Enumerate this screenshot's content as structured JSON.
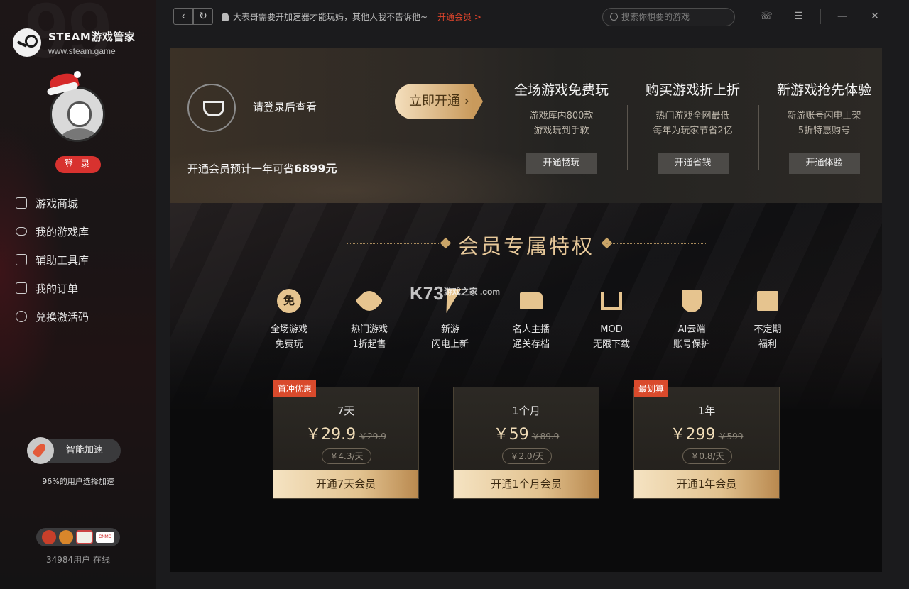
{
  "sidebar": {
    "logo_title": "STEAM游戏管家",
    "logo_url": "www.steam.game",
    "login_label": "登 录",
    "nav": [
      {
        "label": "游戏商城",
        "icon": "store-icon"
      },
      {
        "label": "我的游戏库",
        "icon": "gamepad-icon"
      },
      {
        "label": "辅助工具库",
        "icon": "toolbox-icon"
      },
      {
        "label": "我的订单",
        "icon": "order-icon"
      },
      {
        "label": "兑换激活码",
        "icon": "redeem-icon"
      }
    ],
    "speed_label": "智能加速",
    "speed_sub": "96%的用户选择加速",
    "badge_text": "CNMC",
    "online": "34984用户 在线"
  },
  "topbar": {
    "notice": "大表哥需要开加速器才能玩妈，其他人我不告诉他~",
    "notice_link": "开通会员 >",
    "search_placeholder": "搜索你想要的游戏"
  },
  "promo": {
    "login_text": "请登录后查看",
    "save_text_prefix": "开通会员预计一年可省",
    "save_amount": "6899元",
    "open_button": "立即开通",
    "benefits": [
      {
        "title": "全场游戏免费玩",
        "line1": "游戏库内800款",
        "line2": "游戏玩到手软",
        "button": "开通畅玩"
      },
      {
        "title": "购买游戏折上折",
        "line1": "热门游戏全网最低",
        "line2": "每年为玩家节省2亿",
        "button": "开通省钱"
      },
      {
        "title": "新游戏抢先体验",
        "line1": "新游账号闪电上架",
        "line2": "5折特惠购号",
        "button": "开通体验"
      }
    ]
  },
  "members": {
    "title": "会员专属特权",
    "features": [
      {
        "line1": "全场游戏",
        "line2": "免费玩",
        "icon": "free-icon",
        "glyph": "免"
      },
      {
        "line1": "热门游戏",
        "line2": "1折起售",
        "icon": "tag-icon"
      },
      {
        "line1": "新游",
        "line2": "闪电上新",
        "icon": "lightning-icon"
      },
      {
        "line1": "名人主播",
        "line2": "通关存档",
        "icon": "folder-icon"
      },
      {
        "line1": "MOD",
        "line2": "无限下载",
        "icon": "download-icon"
      },
      {
        "line1": "AI云端",
        "line2": "账号保护",
        "icon": "shield-icon"
      },
      {
        "line1": "不定期",
        "line2": "福利",
        "icon": "gift-icon"
      }
    ],
    "plans": [
      {
        "tag": "首冲优惠",
        "duration": "7天",
        "price": "￥29.9",
        "old_price": "￥29.9",
        "daily": "￥4.3/天",
        "button": "开通7天会员"
      },
      {
        "tag": "",
        "duration": "1个月",
        "price": "￥59",
        "old_price": "￥89.9",
        "daily": "￥2.0/天",
        "button": "开通1个月会员"
      },
      {
        "tag": "最划算",
        "duration": "1年",
        "price": "￥299",
        "old_price": "￥599",
        "daily": "￥0.8/天",
        "button": "开通1年会员"
      }
    ],
    "watermark": "K73",
    "watermark_small": "游戏之家 .com"
  },
  "colors": {
    "accent_red": "#d8322f",
    "gold": "#e6c48f",
    "link_red": "#e0452c"
  }
}
